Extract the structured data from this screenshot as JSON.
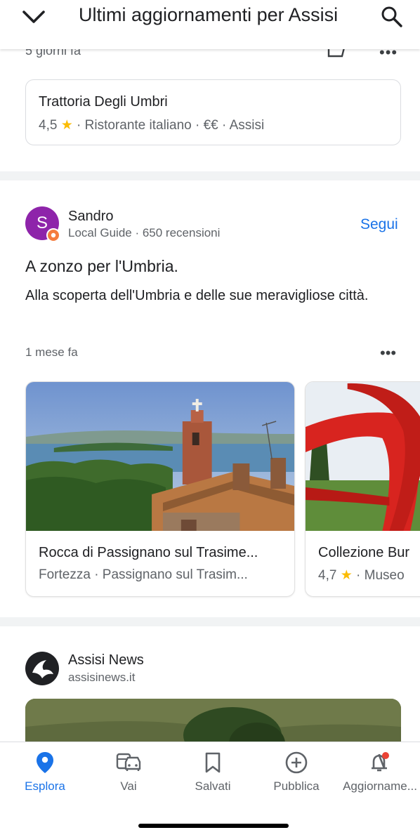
{
  "header": {
    "title": "Ultimi aggiornamenti per Assisi"
  },
  "previous_post": {
    "time": "5 giorni fa"
  },
  "place_card": {
    "name": "Trattoria Degli Umbri",
    "rating": "4,5",
    "meta": "· Ristorante italiano · €€ · Assisi"
  },
  "post": {
    "avatar_letter": "S",
    "author": "Sandro",
    "author_meta": "Local Guide · 650 recensioni",
    "follow_label": "Segui",
    "title": "A zonzo per l'Umbria.",
    "body": "Alla scoperta dell'Umbria e delle sue meravigliose città.",
    "time": "1 mese fa",
    "places": [
      {
        "name": "Rocca di Passignano sul Trasime...",
        "meta": "Fortezza · Passignano sul Trasim..."
      },
      {
        "name": "Collezione Bur",
        "rating": "4,7",
        "meta": "· Museo"
      }
    ]
  },
  "news": {
    "source": "Assisi News",
    "url": "assisinews.it"
  },
  "bottom_nav": {
    "items": [
      {
        "label": "Esplora",
        "icon": "location-pin-icon",
        "active": true
      },
      {
        "label": "Vai",
        "icon": "commute-icon"
      },
      {
        "label": "Salvati",
        "icon": "bookmark-icon"
      },
      {
        "label": "Pubblica",
        "icon": "add-circle-icon"
      },
      {
        "label": "Aggiorname...",
        "icon": "notifications-icon",
        "badge": true
      }
    ]
  },
  "colors": {
    "accent": "#1a73e8",
    "star": "#fbbc04",
    "avatar": "#8e24aa",
    "badge": "#ea4335"
  }
}
